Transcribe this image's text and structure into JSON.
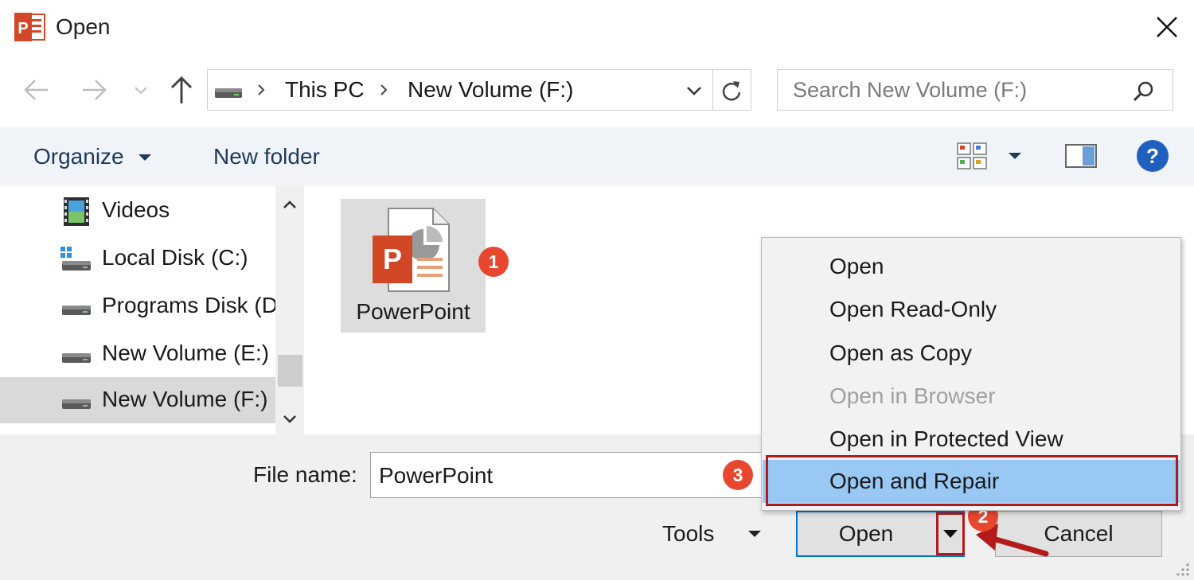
{
  "window": {
    "title": "Open",
    "close_icon": "close-icon"
  },
  "nav": {
    "back_icon": "arrow-left-icon",
    "forward_icon": "arrow-right-icon",
    "recent_icon": "chevron-down-icon",
    "up_icon": "arrow-up-icon"
  },
  "address": {
    "crumbs": [
      "This PC",
      "New Volume (F:)"
    ],
    "refresh_icon": "refresh-icon"
  },
  "search": {
    "placeholder": "Search New Volume (F:)"
  },
  "toolbar": {
    "organize": "Organize",
    "new_folder": "New folder"
  },
  "navpane": {
    "items": [
      {
        "label": "Videos",
        "icon": "film-icon"
      },
      {
        "label": "Local Disk (C:)",
        "icon": "drive-icon"
      },
      {
        "label": "Programs Disk (D:)",
        "icon": "drive-icon"
      },
      {
        "label": "New Volume (E:)",
        "icon": "drive-icon"
      },
      {
        "label": "New Volume (F:)",
        "icon": "drive-icon",
        "selected": true
      }
    ]
  },
  "files": [
    {
      "name": "PowerPoint",
      "icon": "powerpoint-file-icon"
    }
  ],
  "badges": {
    "one": "1",
    "two": "2",
    "three": "3"
  },
  "bottom": {
    "file_name_label": "File name:",
    "file_name_value": "PowerPoint",
    "tools": "Tools",
    "open": "Open",
    "cancel": "Cancel"
  },
  "menu": {
    "items": [
      {
        "label": "Open"
      },
      {
        "label": "Open Read-Only"
      },
      {
        "label": "Open as Copy"
      },
      {
        "label": "Open in Browser",
        "disabled": true
      },
      {
        "label": "Open in Protected View"
      },
      {
        "label": "Open and Repair",
        "highlighted": true
      }
    ]
  },
  "colors": {
    "accent": "#0078d7",
    "powerpoint": "#d24726",
    "badge": "#e8472f",
    "annotation": "#b31b1b",
    "menu_highlight": "#99c8f5"
  }
}
